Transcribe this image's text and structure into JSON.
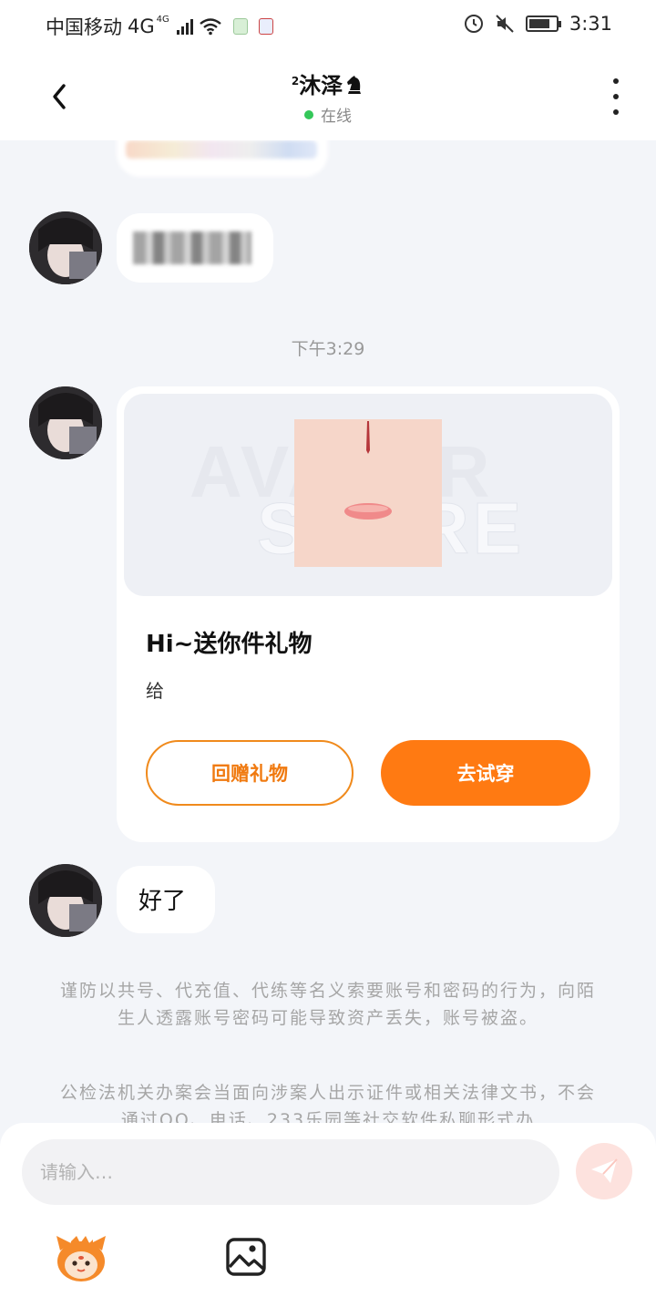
{
  "status_bar": {
    "carrier": "中国移动",
    "network": "4G",
    "network_sup": "4G",
    "time": "3:31"
  },
  "header": {
    "title_sup": "2",
    "title": "沐泽",
    "status": "在线"
  },
  "messages": {
    "timestamp": "下午3:29",
    "gift": {
      "watermark_line1": "AVATAR",
      "watermark_line2": "STORE",
      "title": "Hi~送你件礼物",
      "from_label": "给",
      "return_gift_button": "回赠礼物",
      "try_on_button": "去试穿"
    },
    "last_text": "好了"
  },
  "notices": {
    "notice1": "谨防以共号、代充值、代练等名义索要账号和密码的行为，向陌生人透露账号密码可能导致资产丢失，账号被盗。",
    "notice2": "公检法机关办案会当面向涉案人出示证件或相关法律文书，不会通过QQ、电话、233乐园等社交软件私聊形式办"
  },
  "input_bar": {
    "placeholder": "请输入…"
  },
  "colors": {
    "accent": "#ff7a12",
    "online": "#34c759",
    "background": "#f3f5f9"
  },
  "icons": {
    "back": "chevron-left-icon",
    "more": "more-vertical-icon",
    "send": "send-icon",
    "emoji": "mascot-emoji-icon",
    "image": "image-icon"
  }
}
